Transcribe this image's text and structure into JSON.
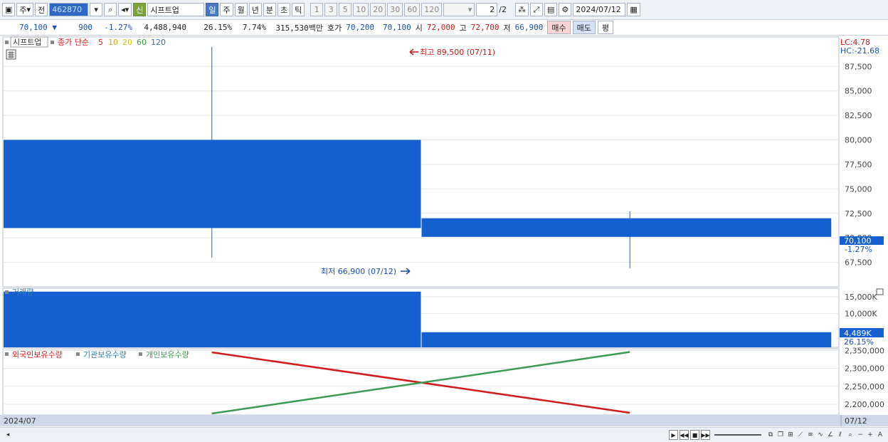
{
  "toolbar": {
    "market": "주",
    "mode": "전",
    "code": "462870",
    "badge": "신",
    "stock_name": "시프트업",
    "periods": [
      "일",
      "주",
      "월",
      "년",
      "분",
      "초",
      "틱"
    ],
    "selected_period": "일",
    "intervals": [
      "1",
      "3",
      "5",
      "10",
      "20",
      "30",
      "60",
      "120"
    ],
    "page": "2",
    "page_total": "/2",
    "date": "2024/07/12"
  },
  "quote": {
    "price": "70,100",
    "change": "900",
    "change_pct": "-1.27%",
    "volume": "4,488,940",
    "turnover": "26.15%",
    "ratio": "7.74%",
    "amount": "315,530백만",
    "bid_label": "호가",
    "bid": "70,200",
    "ask": "70,100",
    "open_label": "시",
    "open": "72,000",
    "high_label": "고",
    "high": "72,700",
    "low_label": "저",
    "low": "66,900",
    "buy_label": "매수",
    "sell_label": "매도",
    "avg_label": "평"
  },
  "colors": {
    "candle": "#1560d0",
    "up": "#d01818",
    "down": "#1c4fb3",
    "foreign": "#d21b1b",
    "institution": "#2f7fa8",
    "individual": "#3d9a52",
    "ma5": "#d62020",
    "ma10": "#e39a13",
    "ma20": "#d8c40a",
    "ma60": "#3b9a3b",
    "ma120": "#2f6fb7"
  },
  "chart_data": [
    {
      "type": "candlestick",
      "title": "시프트업",
      "legend": [
        "종가 단순",
        "5",
        "10",
        "20",
        "60",
        "120"
      ],
      "x": [
        "07/11",
        "07/12"
      ],
      "open": [
        80000,
        72000
      ],
      "high": [
        89500,
        72700
      ],
      "low": [
        68000,
        66900
      ],
      "close": [
        71000,
        70100
      ],
      "ylim": [
        65000,
        90500
      ],
      "yticks": [
        "67,500",
        "70,000",
        "72,500",
        "75,000",
        "77,500",
        "80,000",
        "82,500",
        "85,000",
        "87,500"
      ],
      "last_price": "70,100",
      "last_change": "-1.27%",
      "lc": "LC:4.78",
      "hc": "HC:-21.68",
      "high_annotation": "최고 89,500 (07/11)",
      "low_annotation": "최저 66,900 (07/12)"
    },
    {
      "type": "bar",
      "title": "거래량",
      "x": [
        "07/11",
        "07/12"
      ],
      "values": [
        16500000,
        4488940
      ],
      "ylim": [
        0,
        17500000
      ],
      "yticks": [
        "10,000K",
        "15,000K"
      ],
      "last_value": "4,489K",
      "last_pct": "26.15%"
    },
    {
      "type": "line",
      "legend": [
        "외국인보유수량",
        "기관보유수량",
        "개인보유수량"
      ],
      "x": [
        "07/11",
        "07/12"
      ],
      "series": [
        {
          "name": "외국인보유수량",
          "values": [
            2345000,
            2176000
          ]
        },
        {
          "name": "개인보유수량",
          "values": [
            2174000,
            2346000
          ]
        }
      ],
      "ylim": [
        2170000,
        2355000
      ],
      "yticks": [
        "2,200,000",
        "2,250,000",
        "2,300,000",
        "2,350,000"
      ]
    }
  ],
  "xaxis": {
    "period_label": "2024/07",
    "last_date": "07/12"
  }
}
